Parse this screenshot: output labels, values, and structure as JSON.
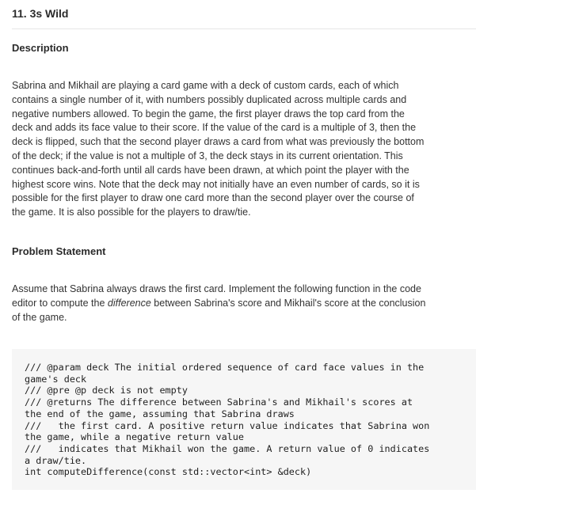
{
  "title": "11. 3s Wild",
  "description": {
    "heading": "Description",
    "lines": [
      "Sabrina and Mikhail are playing a card game with a deck of custom cards, each of which",
      "contains a single number of it, with numbers possibly duplicated across multiple cards and",
      "negative numbers allowed.  To begin the game, the first player draws the top card from the",
      "deck and adds its face value to their score.  If the value of the card is a multiple of 3, then the",
      "deck is flipped, such that the second player draws a card from what was previously the bottom",
      "of the deck; if the value is not a multiple of 3, the deck stays in its current orientation.  This",
      "continues back-and-forth until all cards have been drawn, at which point the player with the",
      "highest score wins.  Note that the deck may not initially have an even number of cards, so it is",
      "possible for the first player to draw one card more than the second player over the course of",
      "the game.  It is also possible for the players to draw/tie."
    ]
  },
  "problem": {
    "heading": "Problem Statement",
    "line1": "Assume that Sabrina always draws the first card.  Implement the following function in the code",
    "line2_before": "editor to compute the ",
    "line2_em": "difference",
    "line2_after": " between Sabrina's score and Mikhail's score at the conclusion",
    "line3": "of the game."
  },
  "code": {
    "lines": [
      "/// @param deck The initial ordered sequence of card face values in the",
      "game's deck",
      "/// @pre @p deck is not empty",
      "/// @returns The difference between Sabrina's and Mikhail's scores at",
      "the end of the game, assuming that Sabrina draws",
      "///   the first card. A positive return value indicates that Sabrina won",
      "the game, while a negative return value",
      "///   indicates that Mikhail won the game. A return value of 0 indicates",
      "a draw/tie.",
      "int computeDifference(const std::vector<int> &deck)"
    ]
  }
}
